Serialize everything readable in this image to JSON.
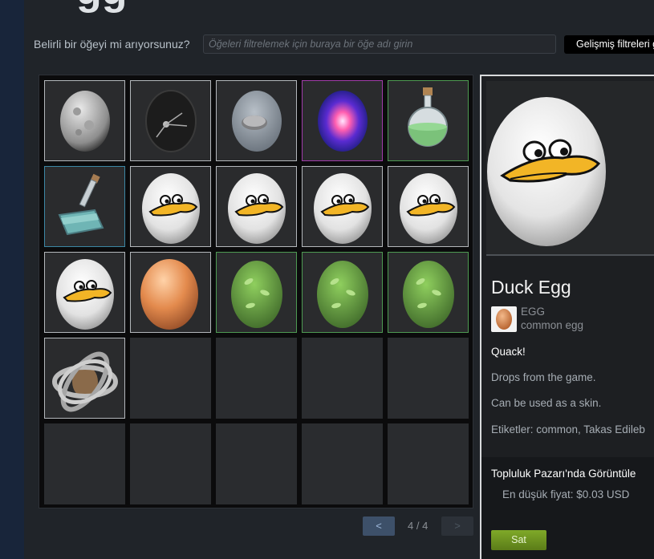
{
  "header": {
    "title_fragment": "gg"
  },
  "filter": {
    "label": "Belirli bir öğeyi mi arıyorsunuz?",
    "placeholder": "Öğeleri filtrelemek için buraya bir öğe adı girin",
    "advanced_label": "Gelişmiş filtreleri g"
  },
  "inventory": {
    "slots": [
      {
        "row": 0,
        "col": 0,
        "kind": "moon-egg",
        "border": "white"
      },
      {
        "row": 0,
        "col": 1,
        "kind": "sputnik-egg",
        "border": "white"
      },
      {
        "row": 0,
        "col": 2,
        "kind": "stone-egg",
        "border": "white"
      },
      {
        "row": 0,
        "col": 3,
        "kind": "galaxy-egg",
        "border": "magenta"
      },
      {
        "row": 0,
        "col": 4,
        "kind": "potion-bottle",
        "border": "green"
      },
      {
        "row": 1,
        "col": 0,
        "kind": "shovel-bottle",
        "border": "blue"
      },
      {
        "row": 1,
        "col": 1,
        "kind": "duck-egg",
        "border": "white"
      },
      {
        "row": 1,
        "col": 2,
        "kind": "duck-egg",
        "border": "white"
      },
      {
        "row": 1,
        "col": 3,
        "kind": "duck-egg",
        "border": "white"
      },
      {
        "row": 1,
        "col": 4,
        "kind": "duck-egg",
        "border": "white"
      },
      {
        "row": 2,
        "col": 0,
        "kind": "duck-egg",
        "border": "white"
      },
      {
        "row": 2,
        "col": 1,
        "kind": "orange-egg",
        "border": "white"
      },
      {
        "row": 2,
        "col": 2,
        "kind": "leaf-egg",
        "border": "green"
      },
      {
        "row": 2,
        "col": 3,
        "kind": "leaf-egg",
        "border": "green"
      },
      {
        "row": 2,
        "col": 4,
        "kind": "leaf-egg",
        "border": "green"
      },
      {
        "row": 3,
        "col": 0,
        "kind": "wire-egg",
        "border": "white"
      }
    ],
    "total_slots": 25
  },
  "pager": {
    "prev_label": "<",
    "next_label": ">",
    "count": "4 / 4"
  },
  "detail": {
    "item_name": "Duck Egg",
    "game_name": "EGG",
    "item_type": "common egg",
    "desc_1": "Quack!",
    "desc_2": "Drops from the game.",
    "desc_3": "Can be used as a skin.",
    "desc_4": "Etiketler: common, Takas Edileb",
    "market_link": "Topluluk Pazarı'nda Görüntüle",
    "market_price": "En düşük fiyat: $0.03 USD",
    "sell_label": "Sat"
  },
  "colors": {
    "accent": "#3d5069",
    "sell": "#6a9022",
    "panel": "#202429"
  }
}
